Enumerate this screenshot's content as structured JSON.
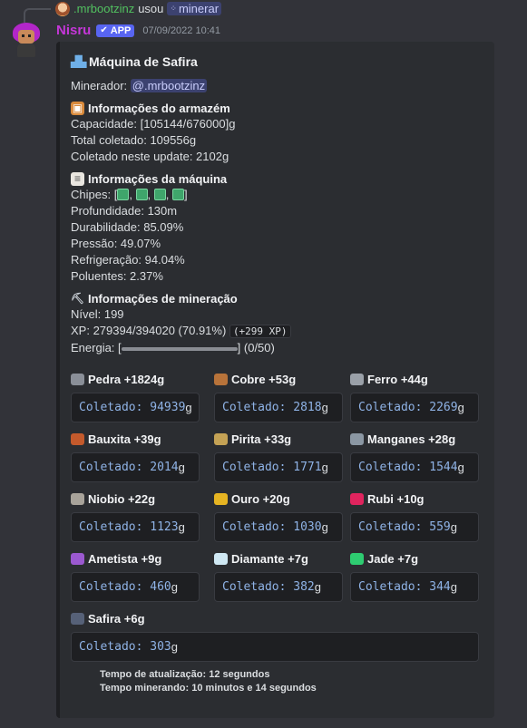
{
  "reply": {
    "username": ".mrbootzinz",
    "action": "usou",
    "command": "minerar"
  },
  "message": {
    "username": "Nisru",
    "badge": "APP",
    "timestamp": "07/09/2022 10:41"
  },
  "embed": {
    "title": "Máquina de Safira",
    "miner_label": "Minerador:",
    "miner_mention": "@.mrbootzinz",
    "storage": {
      "title": "Informações do armazém",
      "capacity": "Capacidade: [105144/676000]g",
      "total": "Total coletado: 109556g",
      "update": "Coletado neste update: 2102g"
    },
    "machine": {
      "title": "Informações da máquina",
      "chips_prefix": "Chipes: [",
      "chips_suffix": "]",
      "depth": "Profundidade: 130m",
      "durability": "Durabilidade: 85.09%",
      "pressure": "Pressão: 49.07%",
      "cooling": "Refrigeração: 94.04%",
      "pollutants": "Poluentes: 2.37%"
    },
    "mining": {
      "title": "Informações de mineração",
      "level": "Nível: 199",
      "xp": "XP: 279394/394020 (70.91%)",
      "xp_gain": "(+299 XP)",
      "energy_label": "Energia: [",
      "energy_value": "] (0/50)",
      "energy_fraction": 0.0
    },
    "collected_label": "Coletado:",
    "unit": "g",
    "minerals": [
      {
        "name": "Pedra +1824g",
        "value": "94939",
        "color": "#8a8f98",
        "icon": "rock-icon"
      },
      {
        "name": "Cobre +53g",
        "value": "2818",
        "color": "#b8733a",
        "icon": "copper-icon"
      },
      {
        "name": "Ferro +44g",
        "value": "2269",
        "color": "#9aa0a8",
        "icon": "iron-icon"
      },
      {
        "name": "Bauxita +39g",
        "value": "2014",
        "color": "#c45a2c",
        "icon": "bauxite-icon"
      },
      {
        "name": "Pirita +33g",
        "value": "1771",
        "color": "#c4a255",
        "icon": "pyrite-icon"
      },
      {
        "name": "Manganes +28g",
        "value": "1544",
        "color": "#8b97a3",
        "icon": "manganese-icon"
      },
      {
        "name": "Niobio +22g",
        "value": "1123",
        "color": "#a8a39a",
        "icon": "niobium-icon"
      },
      {
        "name": "Ouro +20g",
        "value": "1030",
        "color": "#e6b422",
        "icon": "gold-icon"
      },
      {
        "name": "Rubi +10g",
        "value": "559",
        "color": "#e0245e",
        "icon": "ruby-icon"
      },
      {
        "name": "Ametista +9g",
        "value": "460",
        "color": "#9b59d0",
        "icon": "amethyst-icon"
      },
      {
        "name": "Diamante +7g",
        "value": "382",
        "color": "#cfe8f3",
        "icon": "diamond-icon"
      },
      {
        "name": "Jade +7g",
        "value": "344",
        "color": "#2ecc71",
        "icon": "jade-icon"
      },
      {
        "name": "Safira +6g",
        "value": "303",
        "color": "#566178",
        "icon": "sapphire-icon"
      }
    ],
    "footer": {
      "update_time": "Tempo de atualização: 12 segundos",
      "mining_time": "Tempo minerando: 10 minutos e 14 segundos"
    }
  }
}
